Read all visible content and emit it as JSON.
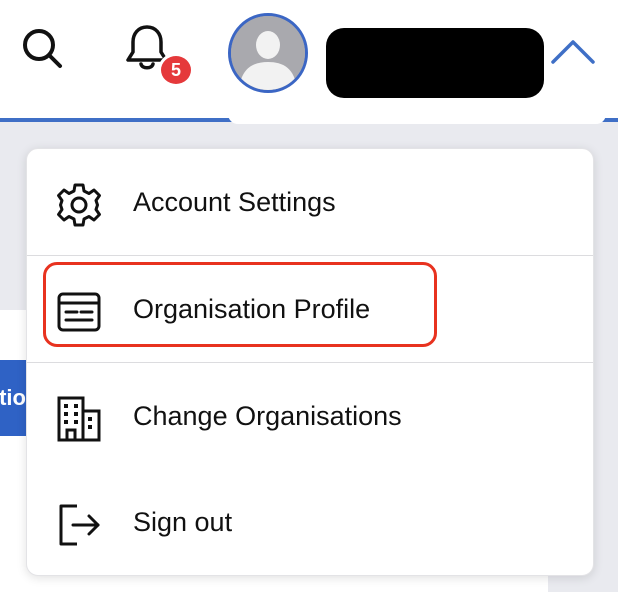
{
  "header": {
    "search_icon": "search-icon",
    "bell_icon": "bell-icon",
    "notification_count": "5",
    "avatar_icon": "user-avatar",
    "chevron_icon": "chevron-up-icon",
    "accent_color": "#3f6fc6",
    "badge_color": "#e5393b"
  },
  "side": {
    "tab_text": "tio"
  },
  "menu": {
    "items": [
      {
        "label": "Account Settings",
        "icon": "gear-icon"
      },
      {
        "label": "Organisation Profile",
        "icon": "profile-card-icon",
        "highlighted": true
      },
      {
        "label": "Change Organisations",
        "icon": "building-icon"
      },
      {
        "label": "Sign out",
        "icon": "sign-out-icon"
      }
    ],
    "highlight_color": "#e8321f"
  }
}
